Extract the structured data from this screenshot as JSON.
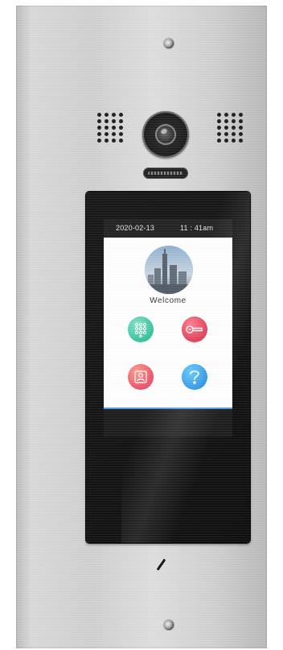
{
  "screen": {
    "status_date": "2020-02-13",
    "status_time": "11 : 41am",
    "welcome_text": "Welcome"
  },
  "icons": {
    "screws": "screw-icon",
    "camera": "camera-icon",
    "keypad": "keypad-icon",
    "key": "key-icon",
    "contacts": "contacts-icon",
    "help": "help-icon"
  },
  "colors": {
    "keypad_green": "#34c29e",
    "key_red": "#e0304a",
    "contacts_pink": "#ec4f68",
    "help_blue": "#1f8fe3",
    "accent_line": "#4a8fd6"
  }
}
